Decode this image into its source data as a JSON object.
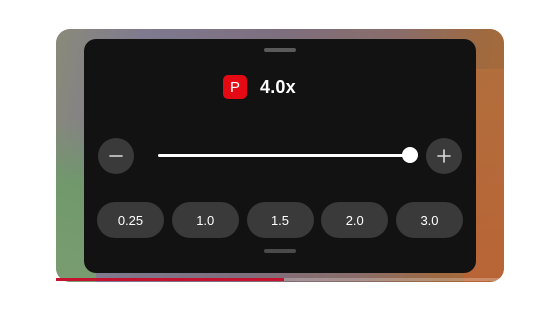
{
  "speed_panel": {
    "logo_letter": "P",
    "current_speed": "4.0x",
    "slider": {
      "min_speed": 0.25,
      "max_speed": 4.0,
      "value": 4.0
    },
    "presets": [
      {
        "label": "0.25"
      },
      {
        "label": "1.0"
      },
      {
        "label": "1.5"
      },
      {
        "label": "2.0"
      },
      {
        "label": "3.0"
      }
    ]
  },
  "video": {
    "progress_fraction": 0.51
  },
  "colors": {
    "panel_bg": "#121212",
    "logo_bg": "#e50914",
    "button_bg": "#3a3a3a",
    "slider_fill": "#ffffff",
    "progress": "#c4122f"
  },
  "icons": {
    "decrease": "minus-icon",
    "increase": "plus-icon"
  }
}
